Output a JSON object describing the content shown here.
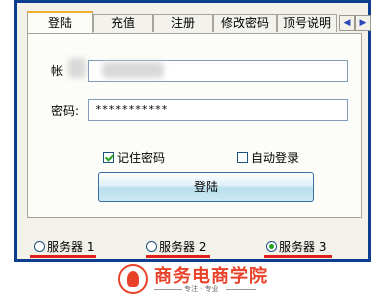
{
  "tabs": [
    {
      "label": "登陆",
      "active": true
    },
    {
      "label": "充值",
      "active": false
    },
    {
      "label": "注册",
      "active": false
    },
    {
      "label": "修改密码",
      "active": false
    },
    {
      "label": "顶号说明",
      "active": false
    }
  ],
  "tab_scroll": {
    "left_icon": "chevron-left-icon",
    "right_icon": "chevron-right-icon"
  },
  "login": {
    "account_label": "帐",
    "account_value": "",
    "password_label": "密码:",
    "password_value": "***********",
    "remember_label": "记住密码",
    "remember_checked": true,
    "autologin_label": "自动登录",
    "autologin_checked": false,
    "submit_label": "登陆"
  },
  "servers": [
    {
      "label": "服务器 1",
      "selected": false
    },
    {
      "label": "服务器 2",
      "selected": false
    },
    {
      "label": "服务器 3",
      "selected": true
    }
  ],
  "logo": {
    "title": "商务电商学院",
    "subtitle": "专注 · 专业"
  },
  "colors": {
    "window_border": "#0c3d8f",
    "accent_red": "#e0201a",
    "check_green": "#22a322"
  }
}
